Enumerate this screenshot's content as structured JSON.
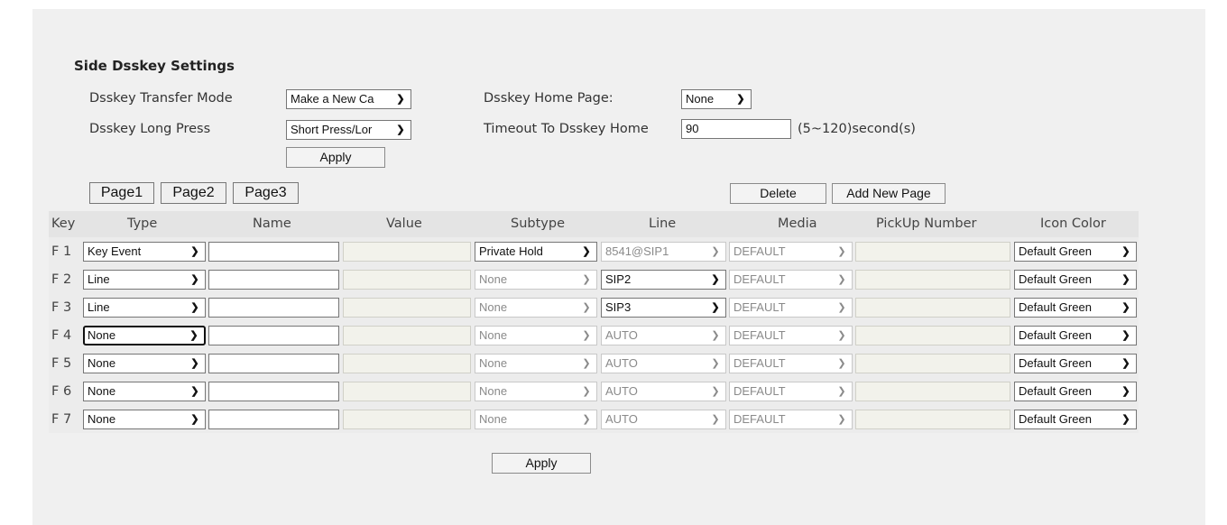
{
  "section_title": "Side Dsskey Settings",
  "settings": {
    "transfer_mode_label": "Dsskey Transfer Mode",
    "transfer_mode_value": "Make a New Ca",
    "long_press_label": "Dsskey Long Press",
    "long_press_value": "Short Press/Lor",
    "home_page_label": "Dsskey Home Page:",
    "home_page_value": "None",
    "timeout_label": "Timeout To Dsskey Home",
    "timeout_value": "90",
    "timeout_hint": "(5~120)second(s)",
    "apply_label": "Apply"
  },
  "pages": [
    "Page1",
    "Page2",
    "Page3"
  ],
  "delete_label": "Delete",
  "add_page_label": "Add New Page",
  "columns": [
    "Key",
    "Type",
    "Name",
    "Value",
    "Subtype",
    "Line",
    "Media",
    "PickUp Number",
    "Icon Color"
  ],
  "rows": [
    {
      "key": "F 1",
      "type": "Key Event",
      "name": "",
      "value": "",
      "subtype": "Private Hold",
      "line": "8541@SIP1",
      "media": "DEFAULT",
      "pickup": "",
      "icon_color": "Default Green"
    },
    {
      "key": "F 2",
      "type": "Line",
      "name": "",
      "value": "",
      "subtype": "None",
      "line": "SIP2",
      "media": "DEFAULT",
      "pickup": "",
      "icon_color": "Default Green"
    },
    {
      "key": "F 3",
      "type": "Line",
      "name": "",
      "value": "",
      "subtype": "None",
      "line": "SIP3",
      "media": "DEFAULT",
      "pickup": "",
      "icon_color": "Default Green"
    },
    {
      "key": "F 4",
      "type": "None",
      "name": "",
      "value": "",
      "subtype": "None",
      "line": "AUTO",
      "media": "DEFAULT",
      "pickup": "",
      "icon_color": "Default Green"
    },
    {
      "key": "F 5",
      "type": "None",
      "name": "",
      "value": "",
      "subtype": "None",
      "line": "AUTO",
      "media": "DEFAULT",
      "pickup": "",
      "icon_color": "Default Green"
    },
    {
      "key": "F 6",
      "type": "None",
      "name": "",
      "value": "",
      "subtype": "None",
      "line": "AUTO",
      "media": "DEFAULT",
      "pickup": "",
      "icon_color": "Default Green"
    },
    {
      "key": "F 7",
      "type": "None",
      "name": "",
      "value": "",
      "subtype": "None",
      "line": "AUTO",
      "media": "DEFAULT",
      "pickup": "",
      "icon_color": "Default Green"
    }
  ],
  "bottom_apply_label": "Apply",
  "icons": {
    "dropdown": "chevron-down-icon"
  }
}
